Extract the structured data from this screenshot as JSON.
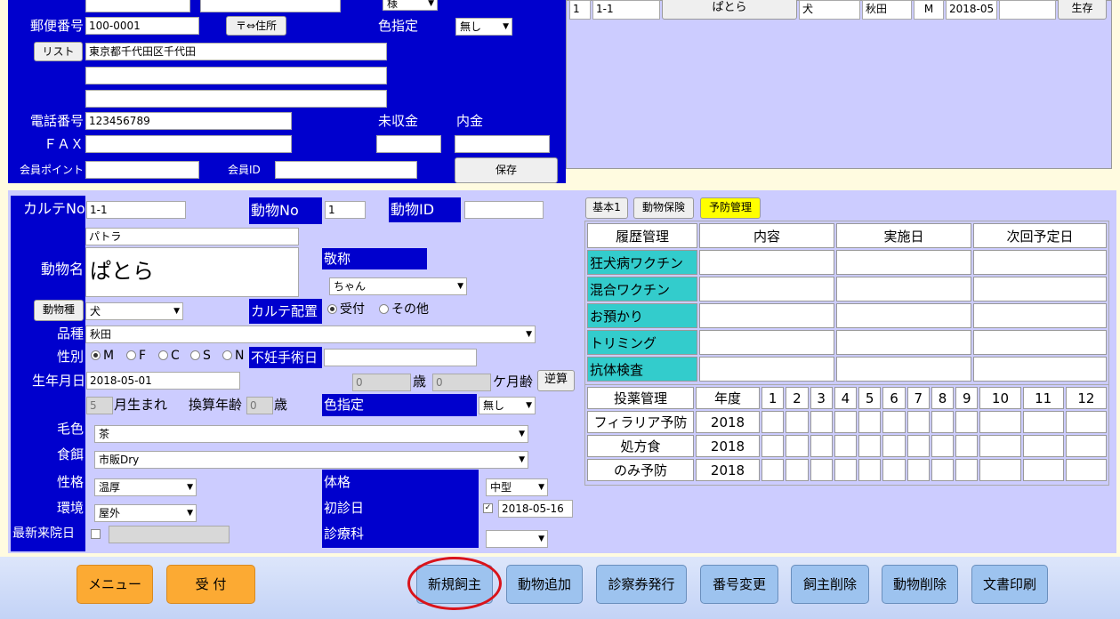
{
  "owner": {
    "postal_label": "郵便番号",
    "postal_value": "100-0001",
    "zip_to_address_button": "〒⇔住所",
    "color_label": "色指定",
    "color_value": "無し",
    "list_button": "リスト",
    "address1": "東京都千代田区千代田",
    "phone_label": "電話番号",
    "phone_value": "123456789",
    "unpaid_label": "未収金",
    "deposit_label": "内金",
    "fax_label": "ＦＡＸ",
    "points_label": "会員ポイント",
    "member_id_label": "会員ID",
    "save_button": "保存",
    "honorific_top": "様"
  },
  "pet_list_row": {
    "no": "1",
    "karte": "1-1",
    "name": "ぱとら",
    "species": "犬",
    "breed": "秋田",
    "sex": "M",
    "birth": "2018-05",
    "status": "生存"
  },
  "animal": {
    "karte_label": "カルテNo",
    "karte_value": "1-1",
    "animal_no_label": "動物No",
    "animal_no_value": "1",
    "animal_id_label": "動物ID",
    "kana": "パトラ",
    "name_label": "動物名",
    "name": "ぱとら",
    "honorific_label": "敬称",
    "honorific_value": "ちゃん",
    "species_button": "動物種",
    "species_value": "犬",
    "karte_place_label": "カルテ配置",
    "place_reception": "受付",
    "place_other": "その他",
    "breed_label": "品種",
    "breed_value": "秋田",
    "sex_label": "性別",
    "sex_m": "M",
    "sex_f": "F",
    "sex_c": "C",
    "sex_s": "S",
    "sex_n": "N",
    "sterilization_label": "不妊手術日",
    "birth_label": "生年月日",
    "birth_value": "2018-05-01",
    "age_years": "0",
    "age_unit": "歳",
    "age_months": "0",
    "months_unit": "ケ月齢",
    "reverse_button": "逆算",
    "born_month": "5",
    "born_text": "月生まれ",
    "converted_age_label": "換算年齢",
    "converted_age": "0",
    "converted_unit": "歳",
    "color_label": "色指定",
    "color_value": "無し",
    "coat_label": "毛色",
    "coat_value": "茶",
    "food_label": "食餌",
    "food_value": "市販Dry",
    "temper_label": "性格",
    "temper_value": "温厚",
    "size_label": "体格",
    "size_value": "中型",
    "env_label": "環境",
    "env_value": "屋外",
    "first_visit_label": "初診日",
    "first_visit_value": "2018-05-16",
    "last_visit_label": "最新来院日",
    "dept_label": "診療科",
    "dept_value": ""
  },
  "tabs": {
    "basic": "基本1",
    "insurance": "動物保険",
    "prevention": "予防管理"
  },
  "history_table": {
    "headers": [
      "履歴管理",
      "内容",
      "実施日",
      "次回予定日"
    ],
    "rows": [
      "狂犬病ワクチン",
      "混合ワクチン",
      "お預かり",
      "トリミング",
      "抗体検査"
    ]
  },
  "dosing_table": {
    "headers": [
      "投薬管理",
      "年度",
      "1",
      "2",
      "3",
      "4",
      "5",
      "6",
      "7",
      "8",
      "9",
      "10",
      "11",
      "12"
    ],
    "rows": [
      {
        "name": "フィラリア予防",
        "year": "2018"
      },
      {
        "name": "処方食",
        "year": "2018"
      },
      {
        "name": "のみ予防",
        "year": "2018"
      }
    ]
  },
  "bottom_bar": {
    "menu": "メニュー",
    "reception": "受 付",
    "new_owner": "新規飼主",
    "add_animal": "動物追加",
    "issue_card": "診察券発行",
    "change_number": "番号変更",
    "delete_owner": "飼主削除",
    "delete_animal": "動物削除",
    "print_docs": "文書印刷"
  },
  "colors": {
    "dark_blue": "#0000cd",
    "panel": "#ccccff",
    "teal_label": "#33cccc",
    "yellow_tab": "#ffff00",
    "highlight_circle": "#d9141b"
  }
}
